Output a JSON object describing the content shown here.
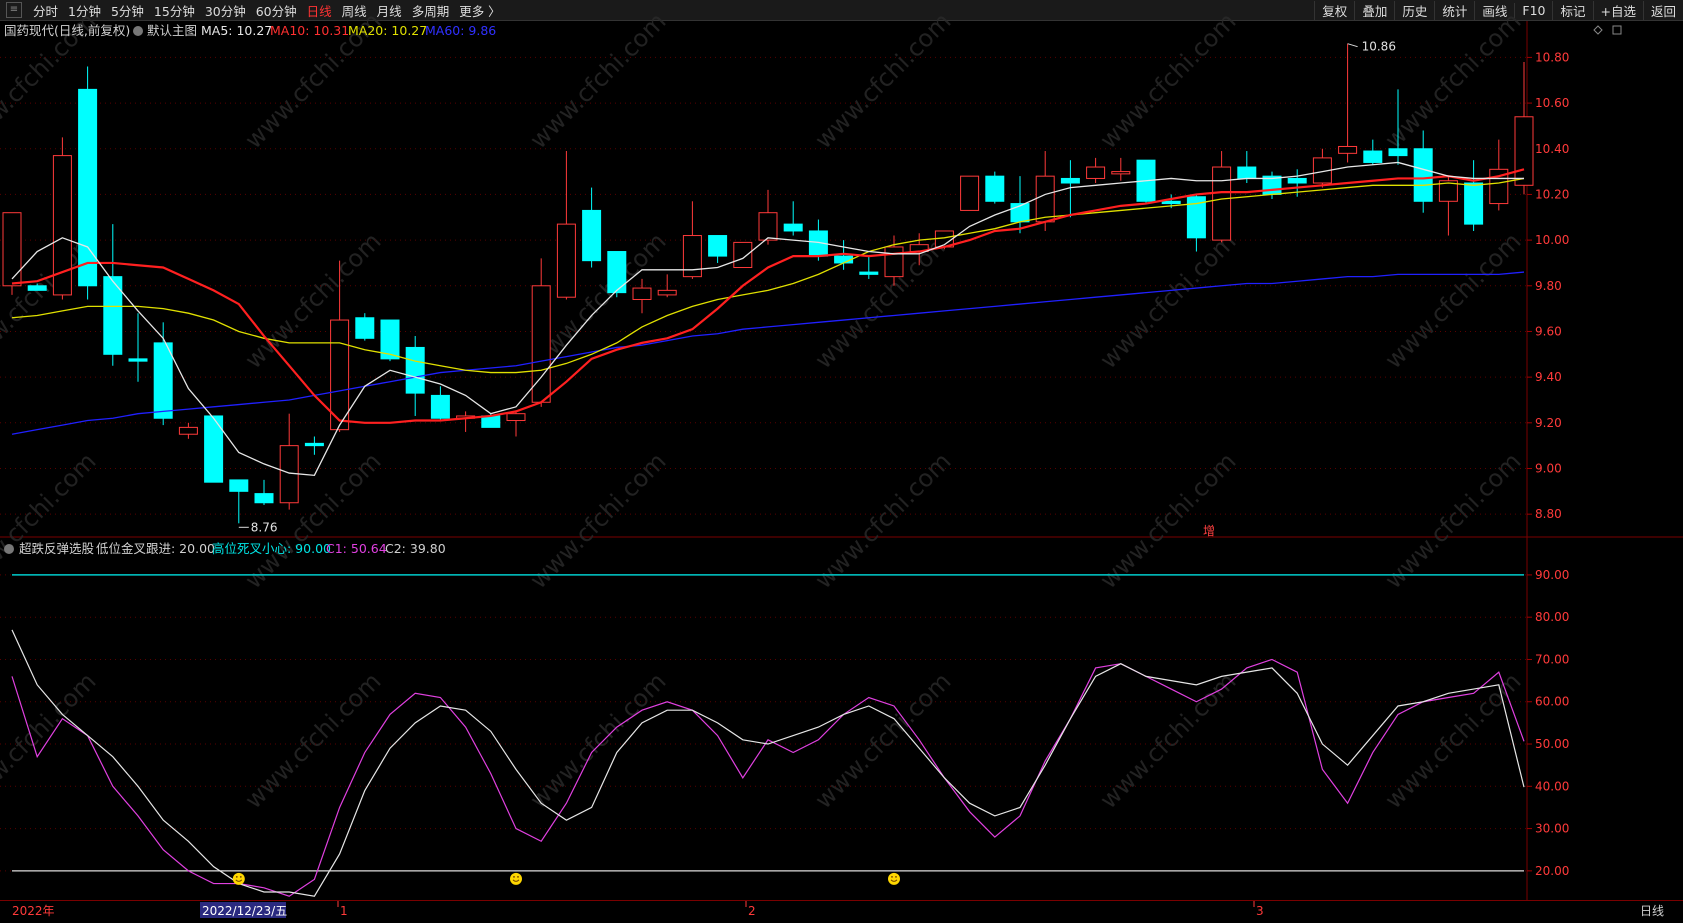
{
  "toolbar": {
    "periods": [
      "分时",
      "1分钟",
      "5分钟",
      "15分钟",
      "30分钟",
      "60分钟",
      "日线",
      "周线",
      "月线",
      "多周期",
      "更多 〉"
    ],
    "active_period": "日线",
    "right_menu": [
      "复权",
      "叠加",
      "历史",
      "统计",
      "画线",
      "F10",
      "标记",
      "+自选",
      "返回"
    ]
  },
  "main_panel": {
    "title": "国药现代(日线,前复权)",
    "template_label": "默认主图",
    "ma5": "MA5: 10.27",
    "ma10": "MA10: 10.31",
    "ma20": "MA20: 10.27",
    "ma60": "MA60: 9.86",
    "high_marker": "10.86",
    "low_marker": "8.76",
    "increase_badge": "增",
    "colors": {
      "up": "#ff3a3a",
      "down": "#00ffff",
      "ma5": "#e6e6e6",
      "ma10": "#ff2020",
      "ma20": "#e0e000",
      "ma60": "#2020ff"
    }
  },
  "indicator_panel": {
    "title": "超跌反弹选股",
    "low_cross": "低位金叉跟进: 20.00",
    "high_cross": "高位死叉小心: 90.00",
    "c1": "C1: 50.64",
    "c2": "C2: 39.80"
  },
  "price_axis": [
    "10.80",
    "10.60",
    "10.40",
    "10.20",
    "10.00",
    "9.80",
    "9.60",
    "9.40",
    "9.20",
    "9.00",
    "8.80"
  ],
  "indicator_axis": [
    "90.00",
    "80.00",
    "70.00",
    "60.00",
    "50.00",
    "40.00",
    "30.00",
    "20.00"
  ],
  "date_axis": {
    "year_label": "2022年",
    "cursor_date": "2022/12/23/五",
    "months": [
      "1",
      "2",
      "3"
    ],
    "period_tag": "日线"
  },
  "watermark": "www.cfchi.com",
  "chart_data": {
    "type": "candlestick",
    "candles": [
      {
        "o": 9.8,
        "h": 10.12,
        "l": 9.76,
        "c": 10.12
      },
      {
        "o": 9.8,
        "h": 9.81,
        "l": 9.79,
        "c": 9.78
      },
      {
        "o": 9.76,
        "h": 10.45,
        "l": 9.74,
        "c": 10.37
      },
      {
        "o": 10.66,
        "h": 10.76,
        "l": 9.74,
        "c": 9.8
      },
      {
        "o": 9.84,
        "h": 10.07,
        "l": 9.45,
        "c": 9.5
      },
      {
        "o": 9.48,
        "h": 9.68,
        "l": 9.38,
        "c": 9.47
      },
      {
        "o": 9.55,
        "h": 9.64,
        "l": 9.19,
        "c": 9.22
      },
      {
        "o": 9.15,
        "h": 9.2,
        "l": 9.13,
        "c": 9.18
      },
      {
        "o": 9.23,
        "h": 9.23,
        "l": 8.94,
        "c": 8.94
      },
      {
        "o": 8.95,
        "h": 8.95,
        "l": 8.76,
        "c": 8.9
      },
      {
        "o": 8.89,
        "h": 8.95,
        "l": 8.84,
        "c": 8.85
      },
      {
        "o": 8.85,
        "h": 9.24,
        "l": 8.82,
        "c": 9.1
      },
      {
        "o": 9.11,
        "h": 9.14,
        "l": 9.06,
        "c": 9.1
      },
      {
        "o": 9.17,
        "h": 9.91,
        "l": 9.16,
        "c": 9.65
      },
      {
        "o": 9.66,
        "h": 9.68,
        "l": 9.56,
        "c": 9.57
      },
      {
        "o": 9.65,
        "h": 9.65,
        "l": 9.47,
        "c": 9.48
      },
      {
        "o": 9.53,
        "h": 9.58,
        "l": 9.23,
        "c": 9.33
      },
      {
        "o": 9.32,
        "h": 9.36,
        "l": 9.21,
        "c": 9.22
      },
      {
        "o": 9.22,
        "h": 9.25,
        "l": 9.16,
        "c": 9.23
      },
      {
        "o": 9.23,
        "h": 9.24,
        "l": 9.18,
        "c": 9.18
      },
      {
        "o": 9.21,
        "h": 9.25,
        "l": 9.14,
        "c": 9.24
      },
      {
        "o": 9.29,
        "h": 9.92,
        "l": 9.27,
        "c": 9.8
      },
      {
        "o": 9.75,
        "h": 10.39,
        "l": 9.74,
        "c": 10.07
      },
      {
        "o": 10.13,
        "h": 10.23,
        "l": 9.88,
        "c": 9.91
      },
      {
        "o": 9.95,
        "h": 9.95,
        "l": 9.75,
        "c": 9.77
      },
      {
        "o": 9.74,
        "h": 9.83,
        "l": 9.68,
        "c": 9.79
      },
      {
        "o": 9.76,
        "h": 9.85,
        "l": 9.75,
        "c": 9.78
      },
      {
        "o": 9.84,
        "h": 10.17,
        "l": 9.83,
        "c": 10.02
      },
      {
        "o": 10.02,
        "h": 10.02,
        "l": 9.9,
        "c": 9.93
      },
      {
        "o": 9.88,
        "h": 9.97,
        "l": 9.88,
        "c": 9.99
      },
      {
        "o": 10.0,
        "h": 10.22,
        "l": 9.98,
        "c": 10.12
      },
      {
        "o": 10.07,
        "h": 10.17,
        "l": 10.02,
        "c": 10.04
      },
      {
        "o": 10.04,
        "h": 10.09,
        "l": 9.91,
        "c": 9.93
      },
      {
        "o": 9.93,
        "h": 10.0,
        "l": 9.87,
        "c": 9.9
      },
      {
        "o": 9.86,
        "h": 9.93,
        "l": 9.83,
        "c": 9.85
      },
      {
        "o": 9.84,
        "h": 10.02,
        "l": 9.8,
        "c": 9.97
      },
      {
        "o": 9.95,
        "h": 10.03,
        "l": 9.89,
        "c": 9.98
      },
      {
        "o": 9.97,
        "h": 10.04,
        "l": 9.96,
        "c": 10.04
      },
      {
        "o": 10.13,
        "h": 10.28,
        "l": 10.13,
        "c": 10.28
      },
      {
        "o": 10.28,
        "h": 10.3,
        "l": 10.16,
        "c": 10.17
      },
      {
        "o": 10.16,
        "h": 10.28,
        "l": 10.03,
        "c": 10.08
      },
      {
        "o": 10.08,
        "h": 10.39,
        "l": 10.04,
        "c": 10.28
      },
      {
        "o": 10.27,
        "h": 10.35,
        "l": 10.1,
        "c": 10.25
      },
      {
        "o": 10.27,
        "h": 10.36,
        "l": 10.25,
        "c": 10.32
      },
      {
        "o": 10.29,
        "h": 10.36,
        "l": 10.26,
        "c": 10.3
      },
      {
        "o": 10.35,
        "h": 10.35,
        "l": 10.16,
        "c": 10.17
      },
      {
        "o": 10.17,
        "h": 10.2,
        "l": 10.14,
        "c": 10.16
      },
      {
        "o": 10.19,
        "h": 10.2,
        "l": 9.95,
        "c": 10.01
      },
      {
        "o": 10.0,
        "h": 10.39,
        "l": 9.99,
        "c": 10.32
      },
      {
        "o": 10.32,
        "h": 10.39,
        "l": 10.25,
        "c": 10.27
      },
      {
        "o": 10.28,
        "h": 10.3,
        "l": 10.18,
        "c": 10.2
      },
      {
        "o": 10.27,
        "h": 10.31,
        "l": 10.19,
        "c": 10.25
      },
      {
        "o": 10.25,
        "h": 10.4,
        "l": 10.23,
        "c": 10.36
      },
      {
        "o": 10.38,
        "h": 10.86,
        "l": 10.34,
        "c": 10.41
      },
      {
        "o": 10.39,
        "h": 10.44,
        "l": 10.33,
        "c": 10.34
      },
      {
        "o": 10.4,
        "h": 10.66,
        "l": 10.33,
        "c": 10.37
      },
      {
        "o": 10.4,
        "h": 10.48,
        "l": 10.12,
        "c": 10.17
      },
      {
        "o": 10.17,
        "h": 10.28,
        "l": 10.02,
        "c": 10.26
      },
      {
        "o": 10.25,
        "h": 10.35,
        "l": 10.04,
        "c": 10.07
      },
      {
        "o": 10.16,
        "h": 10.44,
        "l": 10.13,
        "c": 10.31
      },
      {
        "o": 10.24,
        "h": 10.78,
        "l": 10.2,
        "c": 10.54
      }
    ],
    "ma5": [
      9.83,
      9.95,
      10.01,
      9.97,
      9.82,
      9.69,
      9.57,
      9.35,
      9.22,
      9.07,
      9.02,
      8.98,
      8.97,
      9.19,
      9.36,
      9.43,
      9.4,
      9.37,
      9.32,
      9.24,
      9.27,
      9.4,
      9.54,
      9.67,
      9.78,
      9.87,
      9.87,
      9.87,
      9.88,
      9.92,
      10.01,
      10.0,
      9.99,
      9.97,
      9.95,
      9.94,
      9.94,
      9.98,
      10.06,
      10.11,
      10.15,
      10.2,
      10.23,
      10.24,
      10.25,
      10.26,
      10.27,
      10.26,
      10.26,
      10.27,
      10.27,
      10.28,
      10.3,
      10.32,
      10.33,
      10.34,
      10.31,
      10.28,
      10.27,
      10.27,
      10.27
    ],
    "ma10": [
      9.81,
      9.82,
      9.86,
      9.9,
      9.9,
      9.89,
      9.88,
      9.83,
      9.78,
      9.72,
      9.58,
      9.45,
      9.32,
      9.21,
      9.2,
      9.2,
      9.21,
      9.21,
      9.22,
      9.23,
      9.25,
      9.29,
      9.38,
      9.48,
      9.52,
      9.55,
      9.57,
      9.61,
      9.7,
      9.8,
      9.88,
      9.93,
      9.93,
      9.94,
      9.93,
      9.94,
      9.95,
      9.97,
      10.0,
      10.04,
      10.05,
      10.08,
      10.11,
      10.13,
      10.15,
      10.16,
      10.18,
      10.2,
      10.21,
      10.21,
      10.22,
      10.23,
      10.24,
      10.25,
      10.26,
      10.27,
      10.27,
      10.28,
      10.26,
      10.28,
      10.31
    ],
    "ma20": [
      9.66,
      9.67,
      9.69,
      9.71,
      9.71,
      9.71,
      9.7,
      9.68,
      9.65,
      9.6,
      9.57,
      9.55,
      9.55,
      9.55,
      9.52,
      9.5,
      9.47,
      9.45,
      9.43,
      9.42,
      9.42,
      9.43,
      9.46,
      9.5,
      9.55,
      9.62,
      9.67,
      9.71,
      9.74,
      9.76,
      9.78,
      9.81,
      9.85,
      9.9,
      9.95,
      9.98,
      10.0,
      10.01,
      10.03,
      10.05,
      10.08,
      10.1,
      10.11,
      10.12,
      10.13,
      10.14,
      10.15,
      10.16,
      10.18,
      10.19,
      10.2,
      10.21,
      10.22,
      10.23,
      10.24,
      10.24,
      10.24,
      10.25,
      10.24,
      10.25,
      10.27
    ],
    "ma60": [
      9.15,
      9.17,
      9.19,
      9.21,
      9.22,
      9.24,
      9.25,
      9.26,
      9.27,
      9.28,
      9.29,
      9.3,
      9.32,
      9.34,
      9.36,
      9.38,
      9.4,
      9.42,
      9.43,
      9.44,
      9.45,
      9.47,
      9.49,
      9.51,
      9.53,
      9.54,
      9.56,
      9.58,
      9.59,
      9.61,
      9.62,
      9.63,
      9.64,
      9.65,
      9.66,
      9.67,
      9.68,
      9.69,
      9.7,
      9.71,
      9.72,
      9.73,
      9.74,
      9.75,
      9.76,
      9.77,
      9.78,
      9.79,
      9.8,
      9.81,
      9.81,
      9.82,
      9.83,
      9.84,
      9.84,
      9.85,
      9.85,
      9.85,
      9.85,
      9.85,
      9.86
    ],
    "c1": [
      66,
      47,
      56,
      52,
      40,
      33,
      25,
      20,
      17,
      17,
      16,
      14,
      18,
      35,
      48,
      57,
      62,
      61,
      54,
      43,
      30,
      27,
      36,
      48,
      54,
      58,
      60,
      58,
      52,
      42,
      51,
      48,
      51,
      57,
      61,
      59,
      51,
      42,
      34,
      28,
      33,
      46,
      56,
      68,
      69,
      66,
      63,
      60,
      63,
      68,
      70,
      67,
      44,
      36,
      48,
      57,
      60,
      61,
      62,
      67,
      50.64
    ],
    "c2": [
      77,
      64,
      57,
      52,
      47,
      40,
      32,
      27,
      21,
      17,
      15,
      15,
      14,
      24,
      39,
      49,
      55,
      59,
      58,
      53,
      44,
      36,
      32,
      35,
      48,
      55,
      58,
      58,
      55,
      51,
      50,
      52,
      54,
      57,
      59,
      56,
      49,
      42,
      36,
      33,
      35,
      45,
      56,
      66,
      69,
      66,
      65,
      64,
      66,
      67,
      68,
      62,
      50,
      45,
      52,
      59,
      60,
      62,
      63,
      64,
      39.8
    ],
    "signals": [
      9,
      20,
      35
    ],
    "y_price_range": [
      8.7,
      10.92
    ],
    "y_indicator_range": [
      15,
      94
    ]
  }
}
